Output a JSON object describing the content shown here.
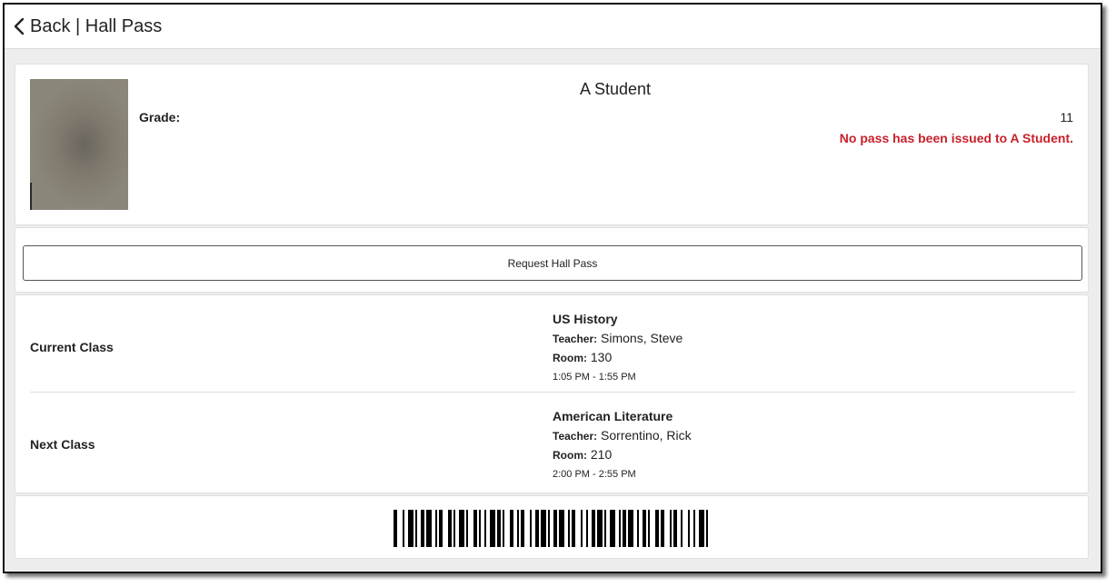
{
  "header": {
    "title": "Back | Hall Pass",
    "back_icon": "chevron-left-icon"
  },
  "student": {
    "name": "A Student",
    "grade_label": "Grade:",
    "grade_value": "11",
    "status_message": "No pass has been issued to A Student.",
    "status_color": "#c8202a"
  },
  "request": {
    "button_label": "Request Hall Pass"
  },
  "classes": [
    {
      "label": "Current Class",
      "course": "US History",
      "teacher_label": "Teacher:",
      "teacher": "Simons, Steve",
      "room_label": "Room:",
      "room": "130",
      "time": "1:05 PM - 1:55 PM"
    },
    {
      "label": "Next Class",
      "course": "American Literature",
      "teacher_label": "Teacher:",
      "teacher": "Sorrentino, Rick",
      "room_label": "Room:",
      "room": "210",
      "time": "2:00 PM - 2:55 PM"
    }
  ],
  "barcode": {
    "icon": "barcode"
  }
}
